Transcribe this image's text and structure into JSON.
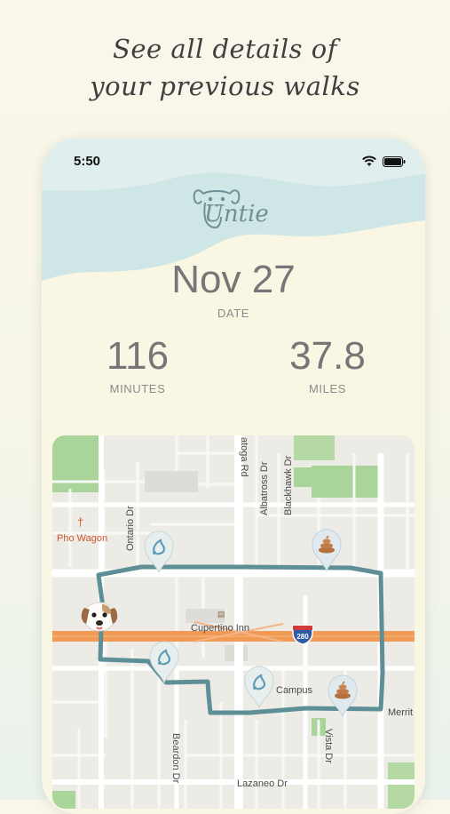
{
  "headline": {
    "line1": "See all details of",
    "line2": "your previous walks"
  },
  "status_bar": {
    "time": "5:50",
    "icons": [
      "wifi-icon",
      "battery-icon"
    ]
  },
  "app": {
    "logo_text": "Untie",
    "logo_icon": "dog-face-icon"
  },
  "walk": {
    "date_value": "Nov 27",
    "date_label": "DATE",
    "minutes_value": "116",
    "minutes_label": "MINUTES",
    "miles_value": "37.8",
    "miles_label": "MILES"
  },
  "map": {
    "streets": {
      "saratoga": "atoga Rd",
      "albatross": "Albatross Dr",
      "blackhawk": "Blackhawk Dr",
      "ontario": "Ontario Dr",
      "beardon": "Beardon Dr",
      "vista": "Vista Dr",
      "lazaneo": "Lazaneo Dr",
      "merrit": "Merrit"
    },
    "places": {
      "pho_wagon": "Pho Wagon",
      "cupertino_inn": "Cupertino Inn",
      "campus": "Campus"
    },
    "highway_number": "280",
    "markers": [
      "pee-marker-icon",
      "poop-marker-icon",
      "pee-marker-icon",
      "pee-marker-icon",
      "poop-marker-icon"
    ],
    "colors": {
      "route": "#5e8f96",
      "freeway": "#f09a55",
      "park": "#a9d49a",
      "background": "#ecebe6"
    }
  }
}
